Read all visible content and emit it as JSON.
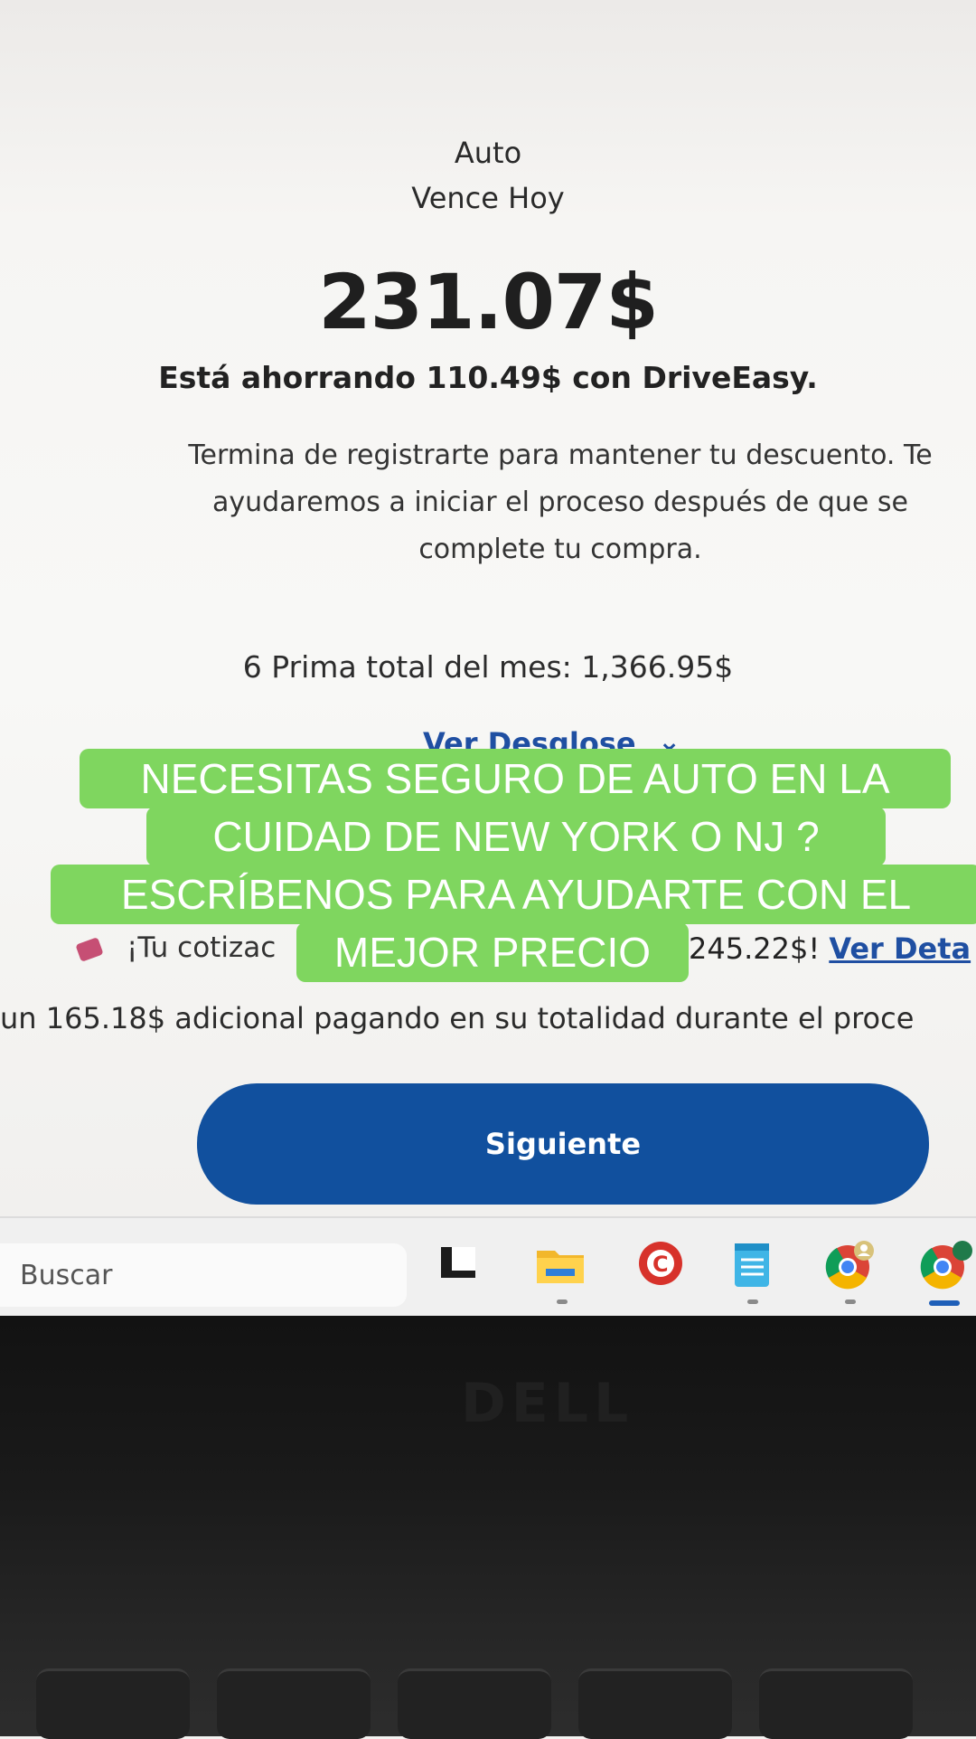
{
  "checkout": {
    "product": "Auto",
    "due": "Vence Hoy",
    "amount": "231.07$",
    "saving": "Está ahorrando 110.49$ con DriveEasy.",
    "description": "Termina de registrarte para mantener tu descuento. Te ayudaremos a iniciar el proceso después de que se complete tu compra.",
    "total": "6 Prima total del mes: 1,366.95$",
    "breakdown_link": "Ver Desglose",
    "quote_left": "¡Tu cotizac",
    "quote_right": "245.22$!",
    "quote_link": "Ver Deta",
    "extra": "un 165.18$ adicional pagando en su totalidad durante el proce",
    "next_button": "Siguiente"
  },
  "taskbar": {
    "search_placeholder": "Buscar",
    "icons": [
      "task-view-icon",
      "file-explorer-icon",
      "security-app-icon",
      "notepad-icon",
      "chrome-profile-icon",
      "chrome-icon"
    ]
  },
  "laptop": {
    "brand": "DELL"
  },
  "caption": {
    "line1": "NECESITAS SEGURO DE AUTO EN LA",
    "line2": "CUIDAD DE NEW YORK O NJ ?",
    "line3": "ESCRÍBENOS PARA AYUDARTE CON EL",
    "line4": "MEJOR PRECIO"
  },
  "colors": {
    "accent": "#11509e",
    "link": "#1f4fa2",
    "caption_bg": "#7fd65f"
  }
}
